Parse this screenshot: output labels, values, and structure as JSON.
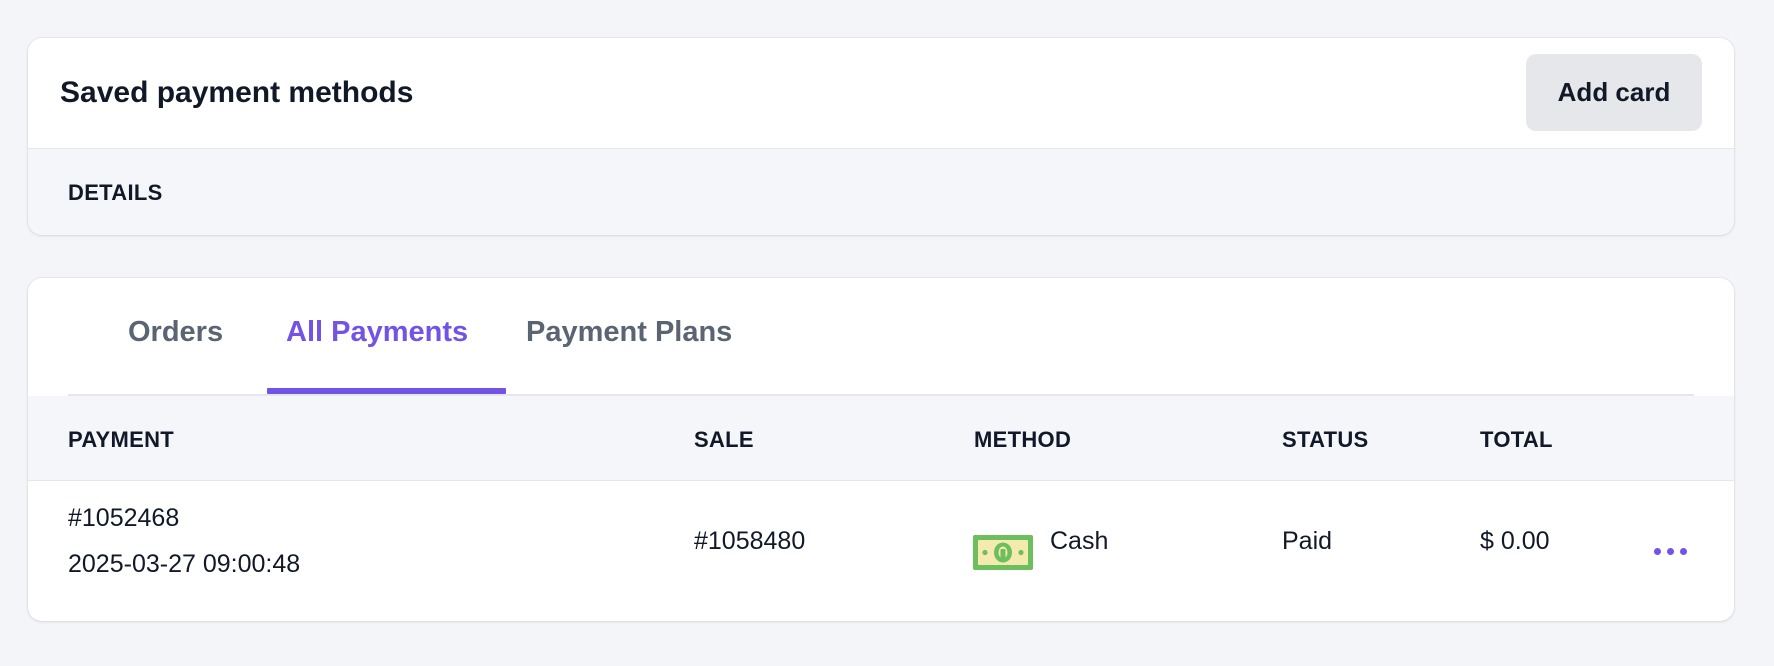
{
  "saved_methods": {
    "title": "Saved payment methods",
    "add_card_label": "Add card",
    "details_label": "DETAILS"
  },
  "tabs": [
    {
      "label": "Orders",
      "active": false
    },
    {
      "label": "All Payments",
      "active": true
    },
    {
      "label": "Payment Plans",
      "active": false
    }
  ],
  "table": {
    "columns": [
      "PAYMENT",
      "SALE",
      "METHOD",
      "STATUS",
      "TOTAL"
    ],
    "rows": [
      {
        "payment_id": "#1052468",
        "payment_date": "2025-03-27 09:00:48",
        "sale": "#1058480",
        "method": "Cash",
        "method_icon": "cash-icon",
        "status": "Paid",
        "total": "$ 0.00",
        "actions_icon": "more-horizontal-icon"
      }
    ]
  },
  "colors": {
    "accent": "#7352e6",
    "page_background": "#f4f5f8",
    "header_background": "#f5f6f9",
    "button_background": "#e5e7eb",
    "cash_green": "#6cbf5c",
    "cash_cream": "#f4eab0"
  }
}
